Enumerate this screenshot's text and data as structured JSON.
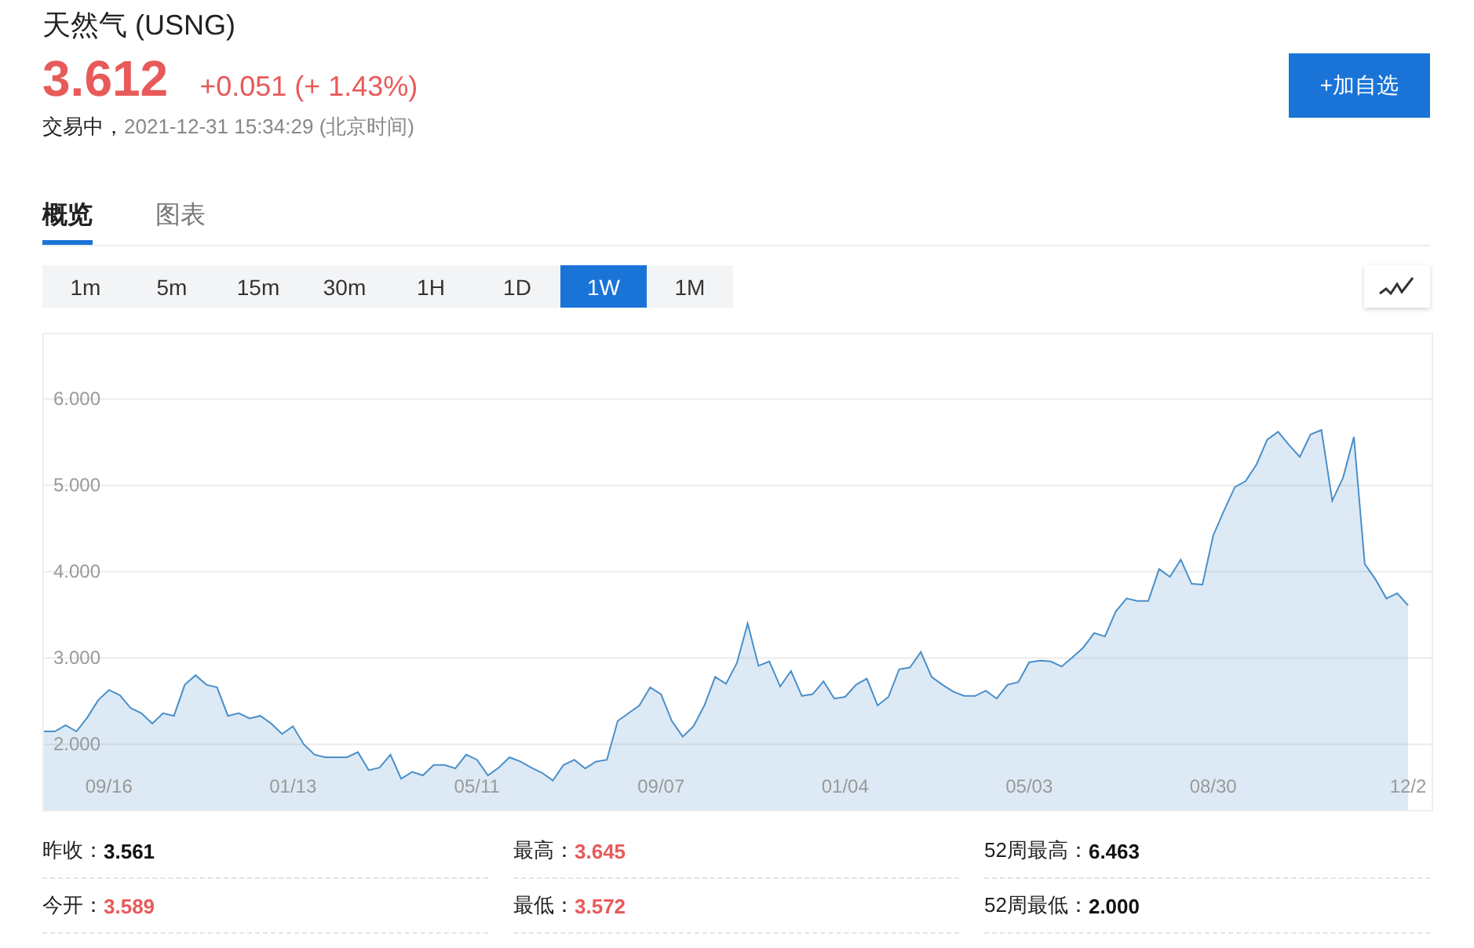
{
  "header": {
    "title": "天然气 (USNG)",
    "price": "3.612",
    "change": "+0.051 (+ 1.43%)",
    "status": "交易中，",
    "time": "2021-12-31 15:34:29 (北京时间)"
  },
  "watchlist_button": "+加自选",
  "tabs": [
    {
      "label": "概览",
      "selected": true
    },
    {
      "label": "图表",
      "selected": false
    }
  ],
  "periods": [
    {
      "label": "1m",
      "selected": false
    },
    {
      "label": "5m",
      "selected": false
    },
    {
      "label": "15m",
      "selected": false
    },
    {
      "label": "30m",
      "selected": false
    },
    {
      "label": "1H",
      "selected": false
    },
    {
      "label": "1D",
      "selected": false
    },
    {
      "label": "1W",
      "selected": true
    },
    {
      "label": "1M",
      "selected": false
    }
  ],
  "chart": {
    "chart_data": {
      "type": "area",
      "grid": true,
      "ylim": [
        1.24,
        6.75
      ],
      "categories": [
        null,
        null,
        null,
        null,
        null,
        null,
        "09/16",
        null,
        null,
        null,
        null,
        null,
        null,
        null,
        null,
        null,
        null,
        null,
        null,
        null,
        null,
        null,
        null,
        "01/13",
        null,
        null,
        null,
        null,
        null,
        null,
        null,
        null,
        null,
        null,
        null,
        null,
        null,
        null,
        null,
        null,
        "05/11",
        null,
        null,
        null,
        null,
        null,
        null,
        null,
        null,
        null,
        null,
        null,
        null,
        null,
        null,
        null,
        null,
        "09/07",
        null,
        null,
        null,
        null,
        null,
        null,
        null,
        null,
        null,
        null,
        null,
        null,
        null,
        null,
        null,
        null,
        "01/04",
        null,
        null,
        null,
        null,
        null,
        null,
        null,
        null,
        null,
        null,
        null,
        null,
        null,
        null,
        null,
        null,
        "05/03",
        null,
        null,
        null,
        null,
        null,
        null,
        null,
        null,
        null,
        null,
        null,
        null,
        null,
        null,
        null,
        null,
        "08/30",
        null,
        null,
        null,
        null,
        null,
        null,
        null,
        null,
        null,
        null,
        null,
        null,
        null,
        null,
        null,
        null,
        null,
        "12/2"
      ],
      "yticks": [
        {
          "value": 2,
          "label": "2.000"
        },
        {
          "value": 3,
          "label": "3.000"
        },
        {
          "value": 4,
          "label": "4.000"
        },
        {
          "value": 5,
          "label": "5.000"
        },
        {
          "value": 6,
          "label": "6.000"
        }
      ],
      "series": [
        {
          "color": "#4a8fca",
          "values": [
            2.15,
            2.15,
            2.22,
            2.15,
            2.31,
            2.51,
            2.63,
            2.57,
            2.42,
            2.36,
            2.24,
            2.36,
            2.33,
            2.69,
            2.8,
            2.69,
            2.66,
            2.33,
            2.36,
            2.3,
            2.33,
            2.24,
            2.12,
            2.21,
            2.0,
            1.88,
            1.85,
            1.85,
            1.85,
            1.91,
            1.7,
            1.73,
            1.88,
            1.6,
            1.68,
            1.64,
            1.76,
            1.76,
            1.72,
            1.88,
            1.82,
            1.64,
            1.73,
            1.85,
            1.8,
            1.73,
            1.67,
            1.58,
            1.76,
            1.82,
            1.72,
            1.8,
            1.82,
            2.27,
            2.36,
            2.45,
            2.66,
            2.58,
            2.27,
            2.09,
            2.21,
            2.45,
            2.78,
            2.7,
            2.94,
            3.4,
            2.91,
            2.96,
            2.67,
            2.85,
            2.56,
            2.58,
            2.73,
            2.53,
            2.55,
            2.69,
            2.76,
            2.45,
            2.55,
            2.87,
            2.89,
            3.07,
            2.78,
            2.69,
            2.61,
            2.56,
            2.56,
            2.62,
            2.53,
            2.69,
            2.72,
            2.95,
            2.97,
            2.96,
            2.9,
            3.01,
            3.12,
            3.29,
            3.25,
            3.54,
            3.69,
            3.66,
            3.66,
            4.03,
            3.94,
            4.14,
            3.86,
            3.85,
            4.42,
            4.71,
            4.98,
            5.05,
            5.24,
            5.53,
            5.62,
            5.47,
            5.33,
            5.59,
            5.64,
            4.82,
            5.09,
            5.56,
            4.09,
            3.91,
            3.69,
            3.75,
            3.61
          ]
        }
      ]
    }
  },
  "stats": [
    {
      "label": "昨收：",
      "value": "3.561",
      "color": "#111111"
    },
    {
      "label": "最高：",
      "value": "3.645",
      "color": "#e85a5a"
    },
    {
      "label": "52周最高：",
      "value": "6.463",
      "color": "#111111"
    },
    {
      "label": "今开：",
      "value": "3.589",
      "color": "#e85a5a"
    },
    {
      "label": "最低：",
      "value": "3.572",
      "color": "#e85a5a"
    },
    {
      "label": "52周最低：",
      "value": "2.000",
      "color": "#111111"
    }
  ]
}
